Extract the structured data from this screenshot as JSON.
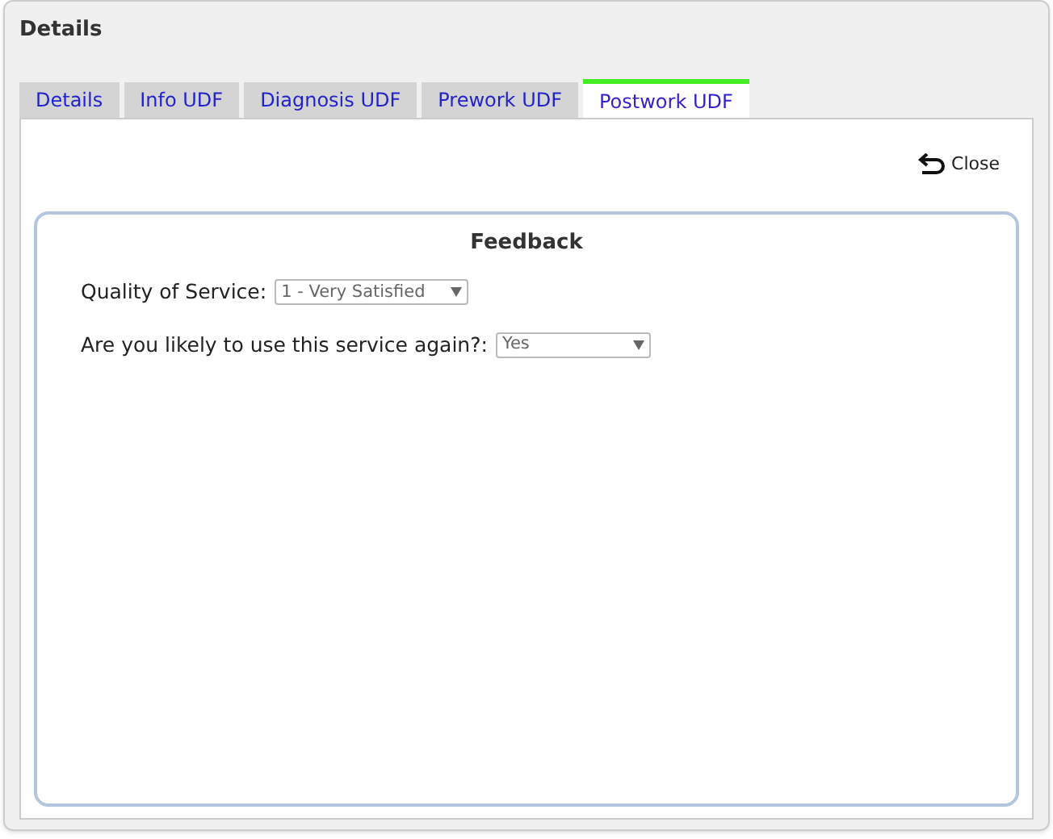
{
  "window": {
    "title": "Details"
  },
  "tabs": [
    {
      "label": "Details",
      "selected": false
    },
    {
      "label": "Info UDF",
      "selected": false
    },
    {
      "label": "Diagnosis UDF",
      "selected": false
    },
    {
      "label": "Prework UDF",
      "selected": false
    },
    {
      "label": "Postwork UDF",
      "selected": true
    }
  ],
  "close_button": {
    "label": "Close"
  },
  "section": {
    "title": "Feedback",
    "fields": [
      {
        "label": "Quality of Service:",
        "value": "1 - Very Satisfied",
        "kind": "select"
      },
      {
        "label": "Are you likely to use this service again?:",
        "value": "Yes",
        "kind": "select"
      }
    ]
  }
}
